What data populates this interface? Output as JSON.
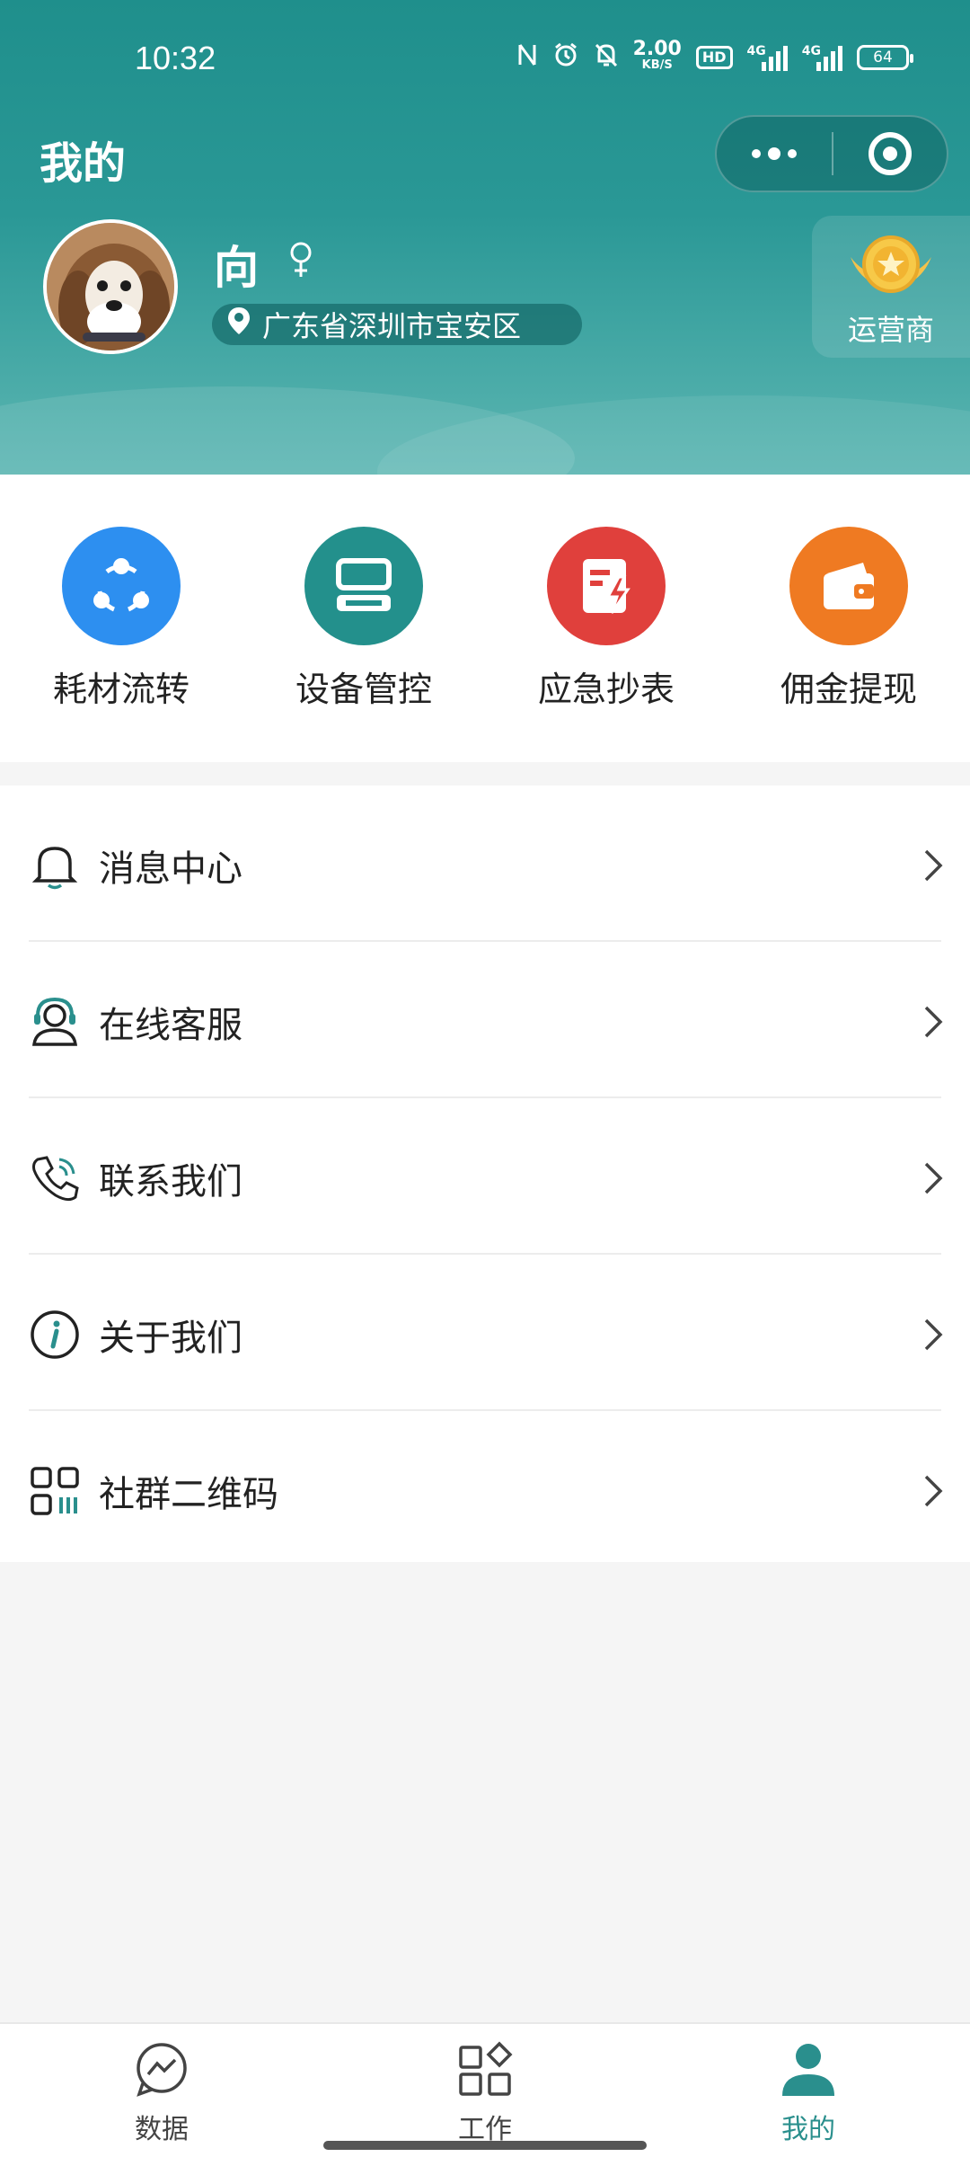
{
  "status_bar": {
    "time": "10:32",
    "net_speed_value": "2.00",
    "net_speed_unit": "KB/S",
    "hd_badge": "HD",
    "signal1_label": "4G",
    "signal2_label": "4G",
    "battery": "64"
  },
  "header": {
    "title": "我的",
    "user_name": "向",
    "location": "广东省深圳市宝安区",
    "role_label": "运营商"
  },
  "quick_actions": [
    {
      "label": "耗材流转",
      "color": "#2d8ff0",
      "icon": "share-cycle-icon"
    },
    {
      "label": "设备管控",
      "color": "#23908c",
      "icon": "device-icon"
    },
    {
      "label": "应急抄表",
      "color": "#e0403c",
      "icon": "meter-flash-icon"
    },
    {
      "label": "佣金提现",
      "color": "#ef7a22",
      "icon": "wallet-icon"
    }
  ],
  "menu": [
    {
      "label": "消息中心",
      "icon": "bell-icon"
    },
    {
      "label": "在线客服",
      "icon": "customer-service-icon"
    },
    {
      "label": "联系我们",
      "icon": "phone-icon"
    },
    {
      "label": "关于我们",
      "icon": "info-icon"
    },
    {
      "label": "社群二维码",
      "icon": "qrcode-icon"
    }
  ],
  "tabbar": {
    "items": [
      {
        "label": "数据",
        "icon": "chart-bubble-icon"
      },
      {
        "label": "工作",
        "icon": "grid-apps-icon"
      },
      {
        "label": "我的",
        "icon": "person-icon"
      }
    ],
    "active_index": 2,
    "active_color": "#2a8f8d"
  }
}
